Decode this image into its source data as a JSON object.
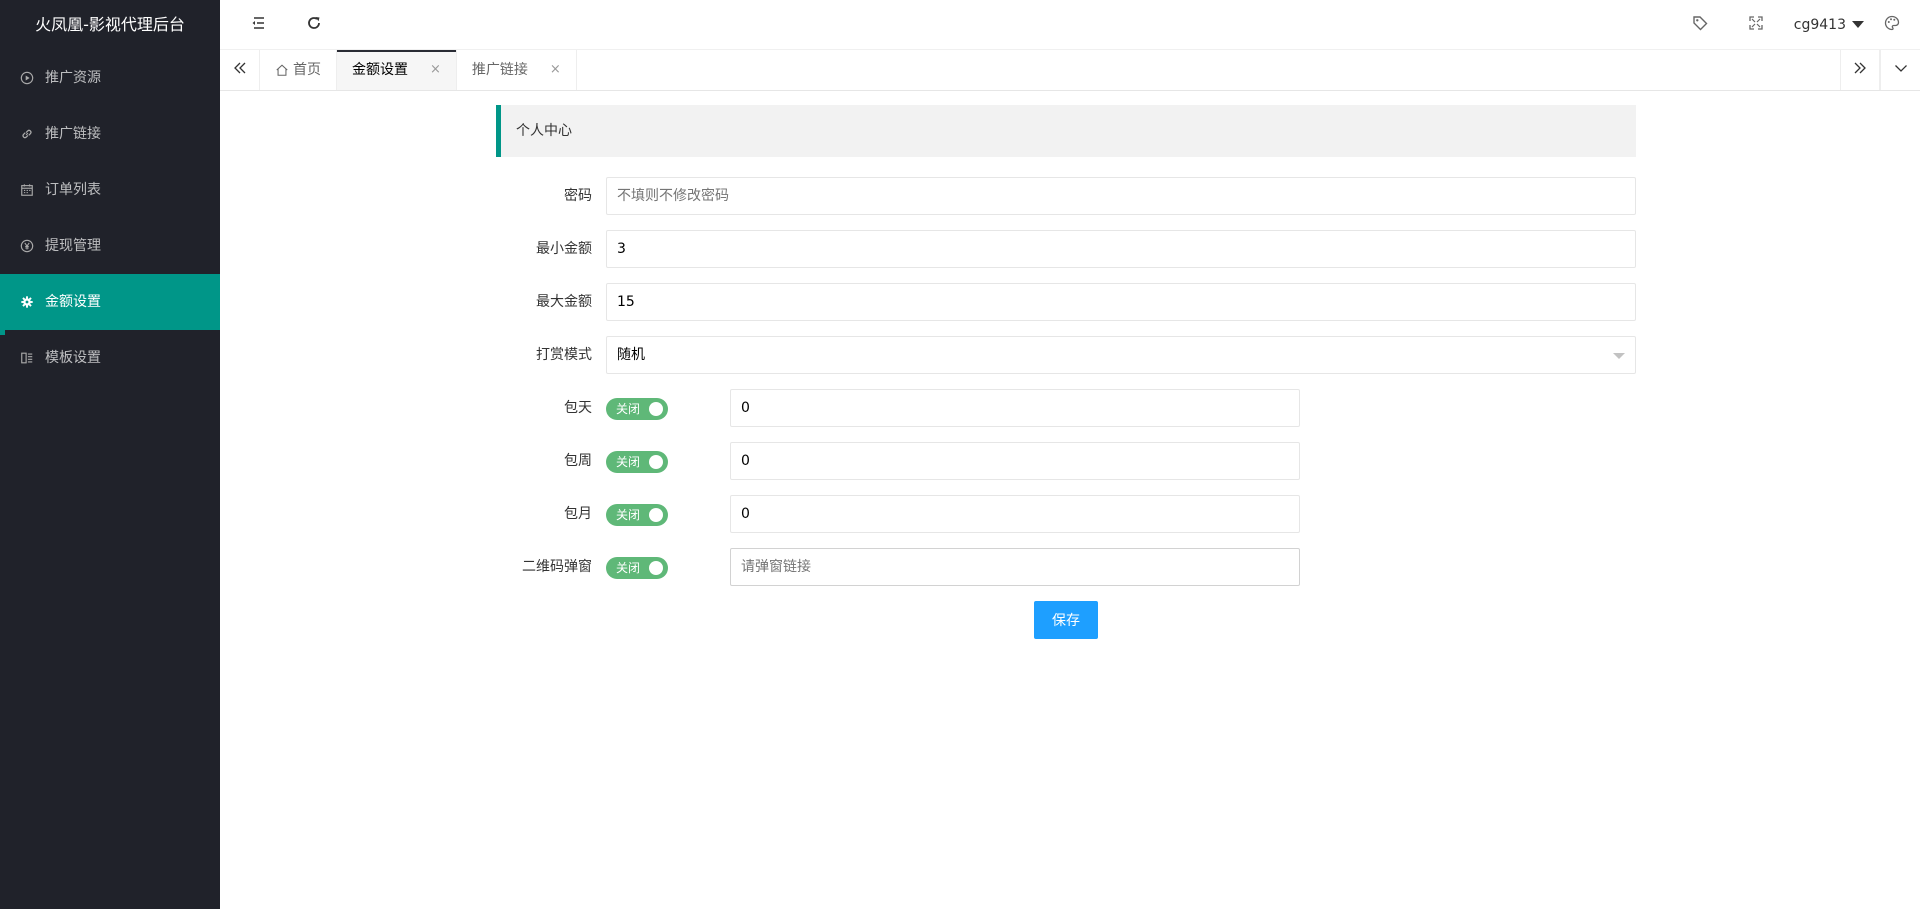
{
  "app": {
    "title": "火凤凰-影视代理后台"
  },
  "sidebar": {
    "items": [
      {
        "label": "推广资源",
        "icon": "play-circle-icon"
      },
      {
        "label": "推广链接",
        "icon": "link-icon"
      },
      {
        "label": "订单列表",
        "icon": "calendar-icon"
      },
      {
        "label": "提现管理",
        "icon": "yen-icon"
      },
      {
        "label": "金额设置",
        "icon": "gear-icon",
        "active": true
      },
      {
        "label": "模板设置",
        "icon": "template-icon"
      }
    ]
  },
  "header": {
    "username": "cg9413"
  },
  "tabs": [
    {
      "label": "首页"
    },
    {
      "label": "金额设置",
      "active": true
    },
    {
      "label": "推广链接"
    }
  ],
  "tab_close_glyph": "×",
  "panel": {
    "title": "个人中心"
  },
  "form": {
    "password": {
      "label": "密码",
      "value": "",
      "placeholder": "不填则不修改密码"
    },
    "min_amount": {
      "label": "最小金额",
      "value": "3"
    },
    "max_amount": {
      "label": "最大金额",
      "value": "15"
    },
    "reward_mode": {
      "label": "打赏模式",
      "value": "随机"
    },
    "daily": {
      "label": "包天",
      "switch_text": "关闭",
      "value": "0"
    },
    "weekly": {
      "label": "包周",
      "switch_text": "关闭",
      "value": "0"
    },
    "monthly": {
      "label": "包月",
      "switch_text": "关闭",
      "value": "0"
    },
    "qr_popup": {
      "label": "二维码弹窗",
      "switch_text": "关闭",
      "value": "",
      "placeholder": "请弹窗链接"
    },
    "save_label": "保存"
  },
  "colors": {
    "sidebar_bg": "#20222a",
    "accent": "#009688",
    "switch": "#5fb878",
    "primary_button": "#1e9fff"
  }
}
